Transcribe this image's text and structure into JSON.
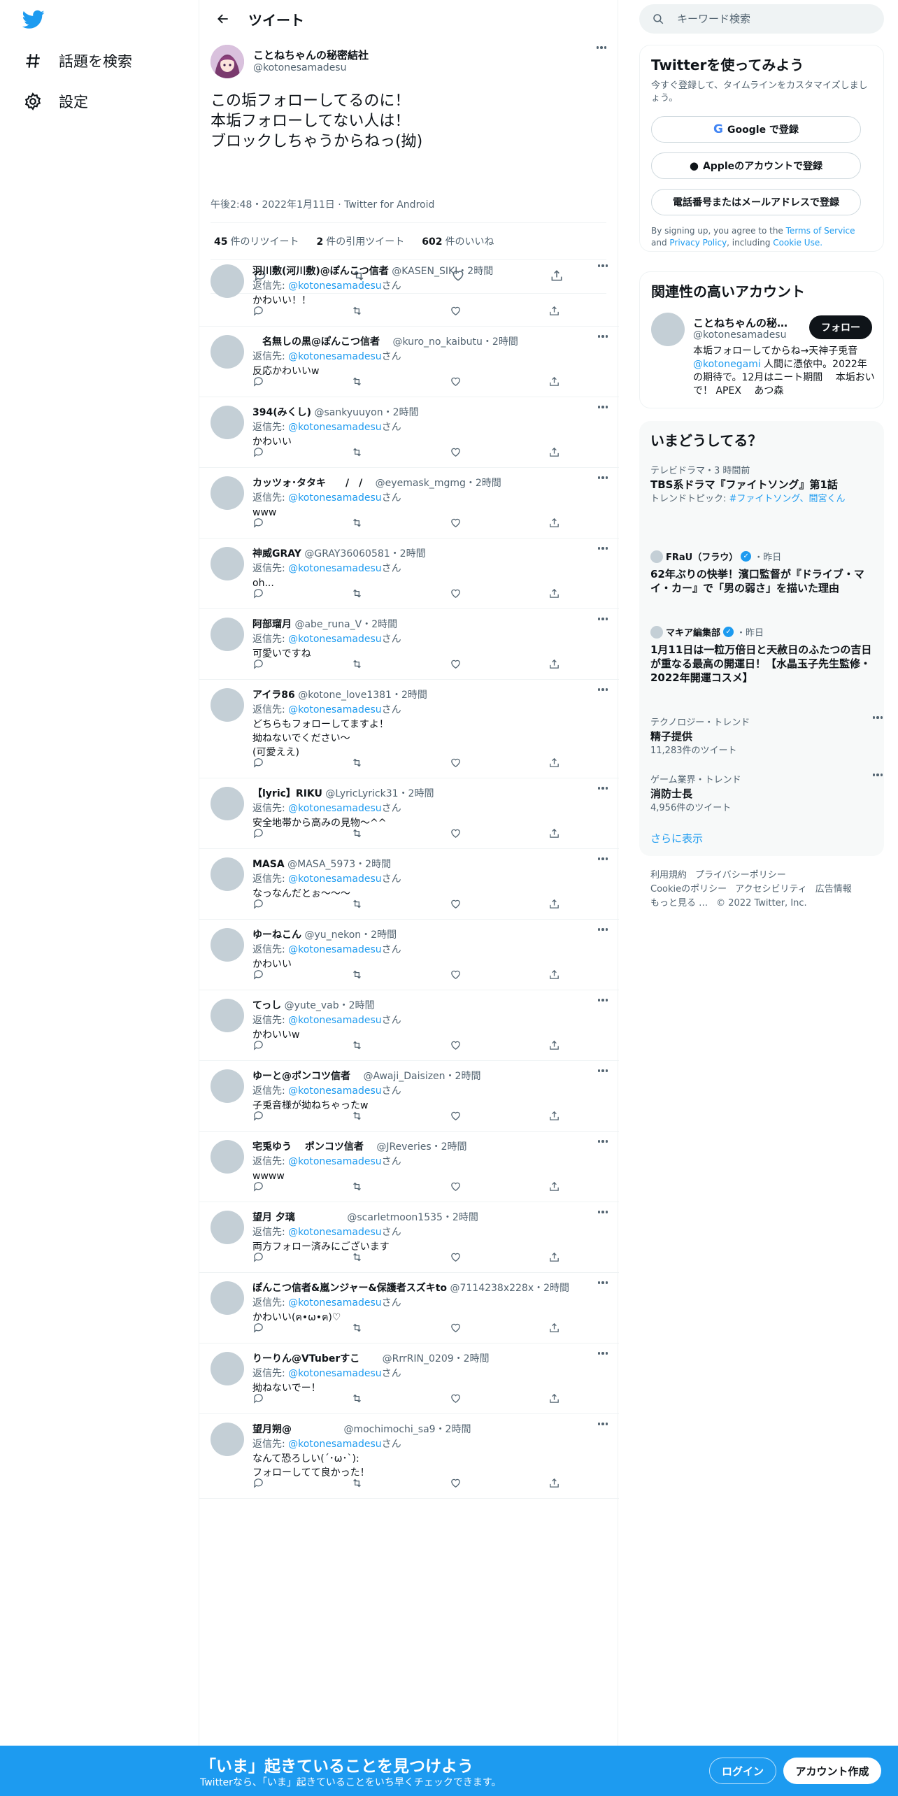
{
  "nav": {
    "explore_label": "話題を検索",
    "settings_label": "設定"
  },
  "header": {
    "title": "ツイート"
  },
  "tweet": {
    "name": "ことねちゃんの秘密結社",
    "handle": "@kotonesamadesu",
    "text": "この垢フォローしてるのに！\n本垢フォローしてない人は！\nブロックしちゃうからねっ(拗)",
    "time": "午後2:48・2022年1月11日",
    "source": "Twitter for Android",
    "retweets": "45",
    "retweets_label": "件のリツイート",
    "quotes": "2",
    "quotes_label": "件の引用ツイート",
    "likes": "602",
    "likes_label": "件のいいね"
  },
  "replies": [
    {
      "name": "羽川敷(河川敷)@ぽんこつ信者",
      "handle": "@KASEN_SIKI",
      "time": "・2時間",
      "to_prefix": "返信先: ",
      "to": "@kotonesamadesu",
      "to_suffix": "さん",
      "text": "かわいい！！"
    },
    {
      "name": "　名無しの黒@ぽんこつ信者",
      "handle": "　@kuro_no_kaibutu",
      "time": "・2時間",
      "to_prefix": "返信先: ",
      "to": "@kotonesamadesu",
      "to_suffix": "さん",
      "text": "反応かわいいw"
    },
    {
      "name": "394(みくし)",
      "handle": "@sankyuuyon",
      "time": "・2時間",
      "to_prefix": "返信先: ",
      "to": "@kotonesamadesu",
      "to_suffix": "さん",
      "text": "かわいい"
    },
    {
      "name": "カッツォ･タタキ　　/　/",
      "handle": "　@eyemask_mgmg",
      "time": "・2時間",
      "to_prefix": "返信先: ",
      "to": "@kotonesamadesu",
      "to_suffix": "さん",
      "text": "www"
    },
    {
      "name": "神威GRAY",
      "handle": "@GRAY36060581",
      "time": "・2時間",
      "to_prefix": "返信先: ",
      "to": "@kotonesamadesu",
      "to_suffix": "さん",
      "text": "oh..."
    },
    {
      "name": "阿部瑠月",
      "handle": "@abe_runa_V",
      "time": "・2時間",
      "to_prefix": "返信先: ",
      "to": "@kotonesamadesu",
      "to_suffix": "さん",
      "text": "可愛いですね"
    },
    {
      "name": "アイラ86",
      "handle": "@kotone_love1381",
      "time": "・2時間",
      "to_prefix": "返信先: ",
      "to": "@kotonesamadesu",
      "to_suffix": "さん",
      "text": "どちらもフォローしてますよ！\n拗ねないでください〜\n(可愛ええ)"
    },
    {
      "name": "【lyric】RIKU",
      "handle": "@LyricLyrick31",
      "time": "・2時間",
      "to_prefix": "返信先: ",
      "to": "@kotonesamadesu",
      "to_suffix": "さん",
      "text": "安全地帯から高みの見物〜^^"
    },
    {
      "name": "MASA",
      "handle": "@MASA_5973",
      "time": "・2時間",
      "to_prefix": "返信先: ",
      "to": "@kotonesamadesu",
      "to_suffix": "さん",
      "text": "なっなんだとぉ～～～"
    },
    {
      "name": "ゆーねこん",
      "handle": "@yu_nekon",
      "time": "・2時間",
      "to_prefix": "返信先: ",
      "to": "@kotonesamadesu",
      "to_suffix": "さん",
      "text": "かわいい"
    },
    {
      "name": "てっし",
      "handle": "@yute_vab",
      "time": "・2時間",
      "to_prefix": "返信先: ",
      "to": "@kotonesamadesu",
      "to_suffix": "さん",
      "text": "かわいいw"
    },
    {
      "name": "ゆーと@ポンコツ信者",
      "handle": "　@Awaji_Daisizen",
      "time": "・2時間",
      "to_prefix": "返信先: ",
      "to": "@kotonesamadesu",
      "to_suffix": "さん",
      "text": "子兎音様が拗ねちゃったw"
    },
    {
      "name": "宅兎ゆう　 ポンコツ信者",
      "handle": "　@JReveries",
      "time": "・2時間",
      "to_prefix": "返信先: ",
      "to": "@kotonesamadesu",
      "to_suffix": "さん",
      "text": "wwww"
    },
    {
      "name": "望月 夕璃",
      "handle": "　　　　　@scarletmoon1535",
      "time": "・2時間",
      "to_prefix": "返信先: ",
      "to": "@kotonesamadesu",
      "to_suffix": "さん",
      "text": "両方フォロー済みにございます"
    },
    {
      "name": "ぽんこつ信者&嵐ンジャー&保護者スズキto",
      "handle": "@7114238x228x",
      "time": "・2時間",
      "to_prefix": "返信先: ",
      "to": "@kotonesamadesu",
      "to_suffix": "さん",
      "text": "かわいい(ค•ω•ค)♡"
    },
    {
      "name": "りーりん@VTuberすこ",
      "handle": "　　@RrrRIN_0209",
      "time": "・2時間",
      "to_prefix": "返信先: ",
      "to": "@kotonesamadesu",
      "to_suffix": "さん",
      "text": "拗ねないでー！"
    },
    {
      "name": "望月朔@",
      "handle": "　　　　　@mochimochi_sa9",
      "time": "・2時間",
      "to_prefix": "返信先: ",
      "to": "@kotonesamadesu",
      "to_suffix": "さん",
      "text": "なんて恐ろしい(´･ω･`):\nフォローしてて良かった！"
    }
  ],
  "search": {
    "placeholder": "キーワード検索"
  },
  "signup_card": {
    "title": "Twitterを使ってみよう",
    "subtitle": "今すぐ登録して、タイムラインをカスタマイズしましょう。",
    "google_label": "Google で登録",
    "apple_label": "Appleのアカウントで登録",
    "phone_label": "電話番号またはメールアドレスで登録",
    "tos_prefix": "By signing up, you agree to the ",
    "tos_terms": "Terms of Service",
    "tos_and": " and ",
    "tos_privacy": "Privacy Policy",
    "tos_including": ", including ",
    "tos_cookie": "Cookie Use."
  },
  "related": {
    "title": "関連性の高いアカウント",
    "name": "ことねちゃんの秘密結社",
    "handle": "@kotonesamadesu",
    "follow_label": "フォロー",
    "bio_1": "本垢フォローしてからね→天神子兎音",
    "bio_link": "@kotonegami",
    "bio_2": " 人間に憑依中。2022年の期待で。12月はニート期間　 本垢おいで！ APEX　 あつ森"
  },
  "trends": {
    "title": "いまどうしてる？",
    "items": [
      {
        "category": "テレビドラマ・3 時間前",
        "title": "TBS系ドラマ『ファイトソング』第1話",
        "sub_prefix": "トレンドトピック: ",
        "sub_link": "#ファイトソング、間宮くん"
      },
      {
        "source": "FRaU（フラウ）",
        "when": "・昨日",
        "title": "62年ぶりの快挙！濱口監督が『ドライブ・マイ・カー』で「男の弱さ」を描いた理由"
      },
      {
        "source": "マキア編集部",
        "when": "・昨日",
        "title": "1月11日は一粒万倍日と天赦日のふたつの吉日が重なる最高の開運日！【水晶玉子先生監修・2022年開運コスメ】"
      },
      {
        "category": "テクノロジー・トレンド",
        "title": "精子提供",
        "count": "11,283件のツイート"
      },
      {
        "category": "ゲーム業界・トレンド",
        "title": "消防士長",
        "count": "4,956件のツイート"
      }
    ],
    "show_more": "さらに表示"
  },
  "footer": {
    "links": [
      "利用規約",
      "プライバシーポリシー",
      "Cookieのポリシー",
      "アクセシビリティ",
      "広告情報",
      "もっと見る …",
      "© 2022 Twitter, Inc."
    ]
  },
  "bottom_bar": {
    "title": "「いま」起きていることを見つけよう",
    "subtitle": "Twitterなら、「いま」起きていることをいち早くチェックできます。",
    "login_label": "ログイン",
    "signup_label": "アカウント作成"
  },
  "colors": {
    "accent": "#1d9bf0",
    "text": "#0f1419",
    "muted": "#536471"
  }
}
